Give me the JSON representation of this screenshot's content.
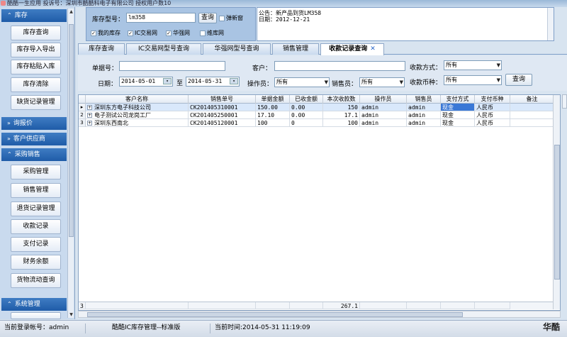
{
  "window": {
    "title": "酷酷一生应用 投诉号：深圳市酷酷科电子有限公司 授权用户数10"
  },
  "sidebar": {
    "sections": [
      {
        "label": "库存",
        "items": [
          "库存查询",
          "库存导入导出",
          "库存粘贴入库",
          "库存清除",
          "缺货记录管理"
        ]
      },
      {
        "label": "询报价",
        "items": []
      },
      {
        "label": "客户供应商",
        "items": []
      },
      {
        "label": "采购销售",
        "items": [
          "采购管理",
          "销售管理",
          "退货记录管理",
          "收款记录",
          "支付记录",
          "财务余额",
          "货物流动查询"
        ]
      },
      {
        "label": "系统管理",
        "items": []
      }
    ]
  },
  "top": {
    "stock_label": "库存型号：",
    "stock_value": "lm358",
    "query_btn": "查询",
    "popup_label": "弹新窗",
    "checks": [
      {
        "label": "我的库存",
        "checked": true
      },
      {
        "label": "IC交易网",
        "checked": true
      },
      {
        "label": "华强网",
        "checked": true
      },
      {
        "label": "维库网",
        "checked": false
      }
    ]
  },
  "announcement": {
    "line1": "公告：新产品到货LM358",
    "line2": "日期：2012-12-21"
  },
  "tabs": [
    {
      "label": "库存查询",
      "active": false
    },
    {
      "label": "IC交易网型号查询",
      "active": false
    },
    {
      "label": "华强网型号查询",
      "active": false
    },
    {
      "label": "销售管理",
      "active": false
    },
    {
      "label": "收款记录查询",
      "active": true,
      "closable": true,
      "close_icon": "✕"
    }
  ],
  "filter": {
    "order_label": "单据号：",
    "order_value": "",
    "customer_label": "客户：",
    "customer_value": "",
    "payment_method_label": "收款方式：",
    "payment_method_value": "所有",
    "date_label": "日期：",
    "date_from": "2014-05-01",
    "date_to_label": "至",
    "date_to": "2014-05-31",
    "operator_label": "操作员：",
    "operator_value": "所有",
    "sales_label": "销售员：",
    "sales_value": "所有",
    "currency_label": "收款币种：",
    "currency_value": "所有",
    "query_btn": "查询"
  },
  "table": {
    "columns": [
      "客户名称",
      "销售单号",
      "单据金额",
      "已收金额",
      "本次收款数",
      "操作员",
      "销售员",
      "支付方式",
      "支付币种",
      "备注"
    ],
    "rows": [
      [
        "深圳东方电子科技公司",
        "CK201405310001",
        "150.00",
        "0.00",
        "150",
        "admin",
        "admin",
        "现金",
        "人民币",
        ""
      ],
      [
        "电子测试公司龙岗工厂",
        "CK201405250001",
        "17.10",
        "0.00",
        "17.1",
        "admin",
        "admin",
        "现金",
        "人民币",
        ""
      ],
      [
        "深圳东西南北",
        "CK201405120001",
        "100",
        "0",
        "100",
        "admin",
        "admin",
        "现金",
        "人民币",
        ""
      ]
    ],
    "row_numbers": [
      "1",
      "2",
      "3"
    ],
    "footer_count": "3",
    "footer_sum": "267.1"
  },
  "status": {
    "login": "当前登录帐号：admin",
    "app": "酷酷IC库存管理--标准版",
    "time": "当前时间:2014-05-31 11:19:09",
    "watermark": "华酷"
  }
}
